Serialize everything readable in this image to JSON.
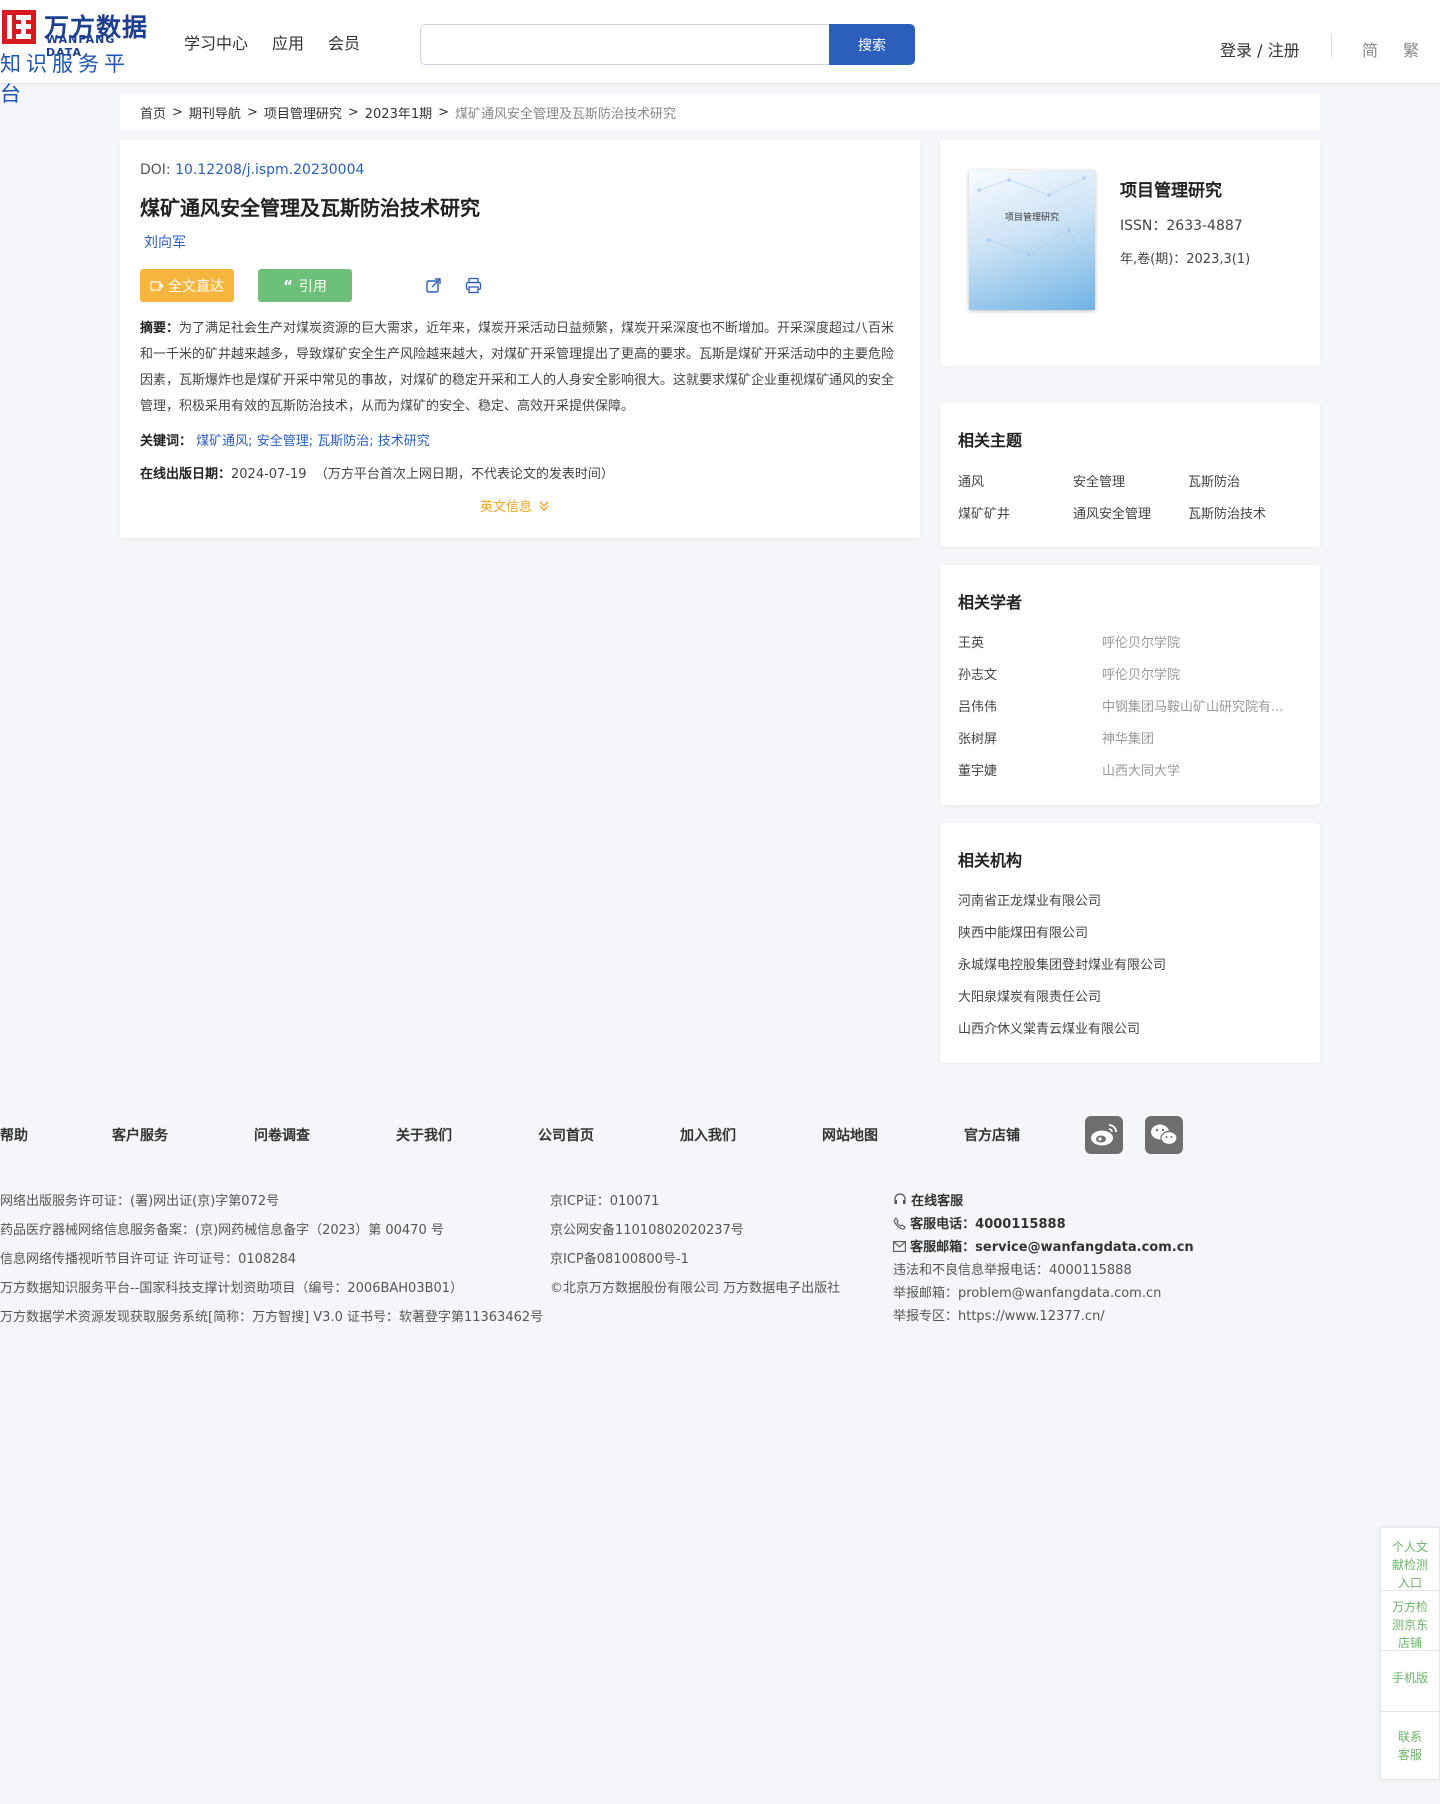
{
  "header": {
    "logo_cn": "万方数据",
    "logo_en": "WANFANG DATA",
    "logo_sub": "知识服务平台",
    "nav": [
      "学习中心",
      "应用",
      "会员"
    ],
    "search_placeholder": "",
    "search_button": "搜索",
    "login": "登录 / 注册",
    "lang_simplified": "简",
    "lang_traditional": "繁"
  },
  "breadcrumb": [
    "首页",
    "期刊导航",
    "项目管理研究",
    "2023年1期",
    "煤矿通风安全管理及瓦斯防治技术研究"
  ],
  "article": {
    "doi_label": "DOI: ",
    "doi": "10.12208/j.ispm.20230004",
    "title": "煤矿通风安全管理及瓦斯防治技术研究",
    "author": "刘向军",
    "btn_fulltext": "全文直达",
    "btn_cite": "引用",
    "abstract_label": "摘要：",
    "abstract": "为了满足社会生产对煤炭资源的巨大需求，近年来，煤炭开采活动日益频繁，煤炭开采深度也不断增加。开采深度超过八百米和一千米的矿井越来越多，导致煤矿安全生产风险越来越大，对煤矿开采管理提出了更高的要求。瓦斯是煤矿开采活动中的主要危险因素，瓦斯爆炸也是煤矿开采中常见的事故，对煤矿的稳定开采和工人的人身安全影响很大。这就要求煤矿企业重视煤矿通风的安全管理，积极采用有效的瓦斯防治技术，从而为煤矿的安全、稳定、高效开采提供保障。",
    "keywords_label": "关键词：",
    "keywords": [
      "煤矿通风;",
      "安全管理;",
      "瓦斯防治;",
      "技术研究"
    ],
    "pubdate_label": "在线出版日期：",
    "pubdate": "2024-07-19",
    "pubdate_note": "（万方平台首次上网日期，不代表论文的发表时间）",
    "en_info": "英文信息"
  },
  "journal": {
    "cover_title": "项目管理研究",
    "name": "项目管理研究",
    "issn": "ISSN：2633-4887",
    "volume": "年,卷(期)：2023,3(1)"
  },
  "topics": {
    "title": "相关主题",
    "items": [
      "通风",
      "安全管理",
      "瓦斯防治",
      "煤矿矿井",
      "通风安全管理",
      "瓦斯防治技术"
    ]
  },
  "scholars": {
    "title": "相关学者",
    "items": [
      {
        "name": "王英",
        "org": "呼伦贝尔学院"
      },
      {
        "name": "孙志文",
        "org": "呼伦贝尔学院"
      },
      {
        "name": "吕伟伟",
        "org": "中钢集团马鞍山矿山研究院有..."
      },
      {
        "name": "张树屏",
        "org": "神华集团"
      },
      {
        "name": "董宇婕",
        "org": "山西大同大学"
      }
    ]
  },
  "institutions": {
    "title": "相关机构",
    "items": [
      "河南省正龙煤业有限公司",
      "陕西中能煤田有限公司",
      "永城煤电控股集团登封煤业有限公司",
      "大阳泉煤炭有限责任公司",
      "山西介休义棠青云煤业有限公司"
    ]
  },
  "footer": {
    "links": [
      "帮助",
      "客户服务",
      "问卷调查",
      "关于我们",
      "公司首页",
      "加入我们",
      "网站地图",
      "官方店铺"
    ],
    "col1": [
      "网络出版服务许可证：(署)网出证(京)字第072号",
      "药品医疗器械网络信息服务备案：(京)网药械信息备字（2023）第 00470 号",
      "信息网络传播视听节目许可证 许可证号：0108284",
      "万方数据知识服务平台--国家科技支撑计划资助项目（编号：2006BAH03B01）",
      "万方数据学术资源发现获取服务系统[简称：万方智搜] V3.0 证书号：软著登字第11363462号"
    ],
    "col2": [
      "京ICP证：010071",
      "京公网安备11010802020237号",
      "京ICP备08100800号-1",
      "©北京万方数据股份有限公司 万方数据电子出版社"
    ],
    "cs_title": "在线客服",
    "cs_phone_label": "客服电话：",
    "cs_phone": "4000115888",
    "cs_email_label": "客服邮箱：",
    "cs_email": "service@wanfangdata.com.cn",
    "report_phone": "违法和不良信息举报电话：4000115888",
    "report_email": "举报邮箱：problem@wanfangdata.com.cn",
    "report_zone": "举报专区：https://www.12377.cn/"
  },
  "float_bar": [
    "个人文献检测入口",
    "万方检测京东店铺",
    "手机版",
    "联系客服"
  ],
  "colors": {
    "brand_blue": "#2c5ebc",
    "logo_red": "#d71920",
    "fulltext_orange": "#f5b53f",
    "cite_green": "#6cc07a",
    "float_green": "#6cb46a"
  }
}
